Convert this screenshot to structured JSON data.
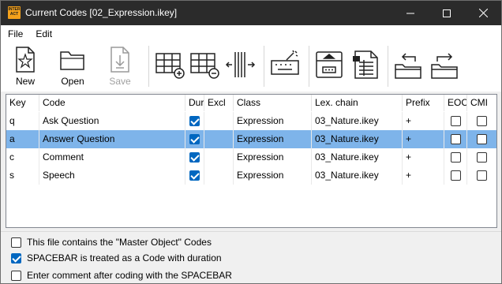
{
  "window": {
    "title": "Current Codes [02_Expression.ikey]",
    "app_icon_text": "INTER ACT",
    "accent_color": "#0067c0",
    "selection_color": "#7eb4ea"
  },
  "menu": [
    {
      "label": "File"
    },
    {
      "label": "Edit"
    }
  ],
  "toolbar": {
    "new_label": "New",
    "open_label": "Open",
    "save_label": "Save",
    "icons": [
      "new-file-icon",
      "open-folder-icon",
      "save-icon",
      "add-row-icon",
      "remove-row-icon",
      "split-columns-icon",
      "keyboard-wand-icon",
      "screen-keyboard-icon",
      "spreadsheet-list-icon",
      "import-folder-icon",
      "export-folder-icon"
    ]
  },
  "grid": {
    "columns": [
      "Key",
      "Code",
      "Dur",
      "Excl",
      "Class",
      "Lex. chain",
      "Prefix",
      "EOC",
      "CMI"
    ],
    "rows": [
      {
        "key": "q",
        "code": "Ask Question",
        "dur": true,
        "excl": false,
        "class": "Expression",
        "lex": "03_Nature.ikey",
        "prefix": "+",
        "eoc": false,
        "cmi": false,
        "selected": false
      },
      {
        "key": "a",
        "code": "Answer Question",
        "dur": true,
        "excl": false,
        "class": "Expression",
        "lex": "03_Nature.ikey",
        "prefix": "+",
        "eoc": false,
        "cmi": false,
        "selected": true
      },
      {
        "key": "c",
        "code": "Comment",
        "dur": true,
        "excl": false,
        "class": "Expression",
        "lex": "03_Nature.ikey",
        "prefix": "+",
        "eoc": false,
        "cmi": false,
        "selected": false
      },
      {
        "key": "s",
        "code": "Speech",
        "dur": true,
        "excl": false,
        "class": "Expression",
        "lex": "03_Nature.ikey",
        "prefix": "+",
        "eoc": false,
        "cmi": false,
        "selected": false
      }
    ]
  },
  "options": [
    {
      "label": "This file contains the \"Master Object\" Codes",
      "checked": false
    },
    {
      "label": "SPACEBAR is treated as a Code with duration",
      "checked": true
    },
    {
      "label": "Enter comment after coding with the SPACEBAR",
      "checked": false
    }
  ]
}
